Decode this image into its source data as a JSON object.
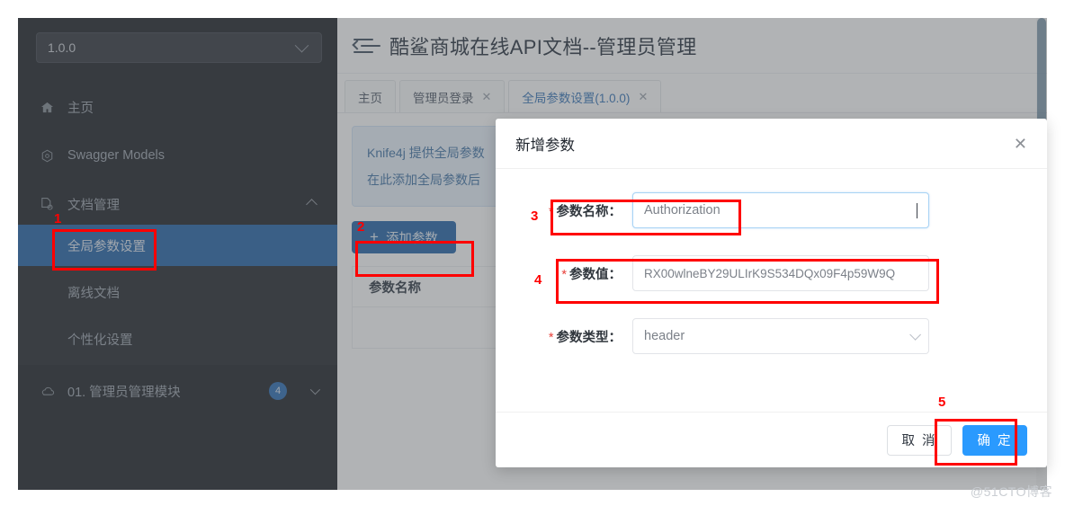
{
  "sidebar": {
    "version_select": {
      "value": "1.0.0",
      "icon": "chevron-down-icon"
    },
    "items": [
      {
        "label": "主页",
        "icon": "home-icon"
      },
      {
        "label": "Swagger Models",
        "icon": "swagger-icon"
      },
      {
        "label": "文档管理",
        "icon": "document-settings-icon",
        "expand_icon": "chevron-up-icon"
      }
    ],
    "sub_items": [
      {
        "label": "全局参数设置",
        "active": true
      },
      {
        "label": "离线文档",
        "active": false
      },
      {
        "label": "个性化设置",
        "active": false
      }
    ],
    "module": {
      "label": "01. 管理员管理模块",
      "count": "4",
      "icon": "cloud-icon",
      "expand_icon": "chevron-down-icon"
    }
  },
  "header": {
    "collapse_icon": "menu-collapse-icon",
    "title": "酷鲨商城在线API文档--管理员管理"
  },
  "tabs": [
    {
      "label": "主页",
      "closable": false,
      "active": false
    },
    {
      "label": "管理员登录",
      "closable": true,
      "close_glyph": "✕",
      "active": false
    },
    {
      "label": "全局参数设置(1.0.0)",
      "closable": true,
      "close_glyph": "✕",
      "active": true
    }
  ],
  "content": {
    "info_line1": "Knife4j 提供全局参数",
    "info_line2": "在此添加全局参数后",
    "add_button": {
      "label": "添加参数",
      "plus": "+"
    },
    "table_header": "参数名称"
  },
  "modal": {
    "title": "新增参数",
    "close_glyph": "✕",
    "fields": [
      {
        "required_star": "*",
        "label": "参数名称：",
        "value": "Authorization",
        "type": "text",
        "focused": true
      },
      {
        "required_star": "*",
        "label": "参数值：",
        "value": "RX00wlneBY29ULIrK9S534DQx09F4p59W9Q",
        "type": "text",
        "focused": false
      },
      {
        "required_star": "*",
        "label": "参数类型：",
        "value": "header",
        "type": "select",
        "focused": false
      }
    ],
    "cancel_label": "取 消",
    "confirm_label": "确 定"
  },
  "annotations": [
    {
      "num": "1",
      "target": "sidebar-global-param-setting"
    },
    {
      "num": "2",
      "target": "add-parameter-button"
    },
    {
      "num": "3",
      "target": "param-name-field"
    },
    {
      "num": "4",
      "target": "param-value-field"
    },
    {
      "num": "5",
      "target": "confirm-button"
    }
  ],
  "watermark": "@51CTO博客",
  "colors": {
    "sidebar_bg": "#16191f",
    "active_nav": "#1b5ea6",
    "primary_button": "#2a9afe",
    "add_button": "#1b5ea6",
    "annotation_red": "#ff0000",
    "required_star": "#e8403a"
  }
}
